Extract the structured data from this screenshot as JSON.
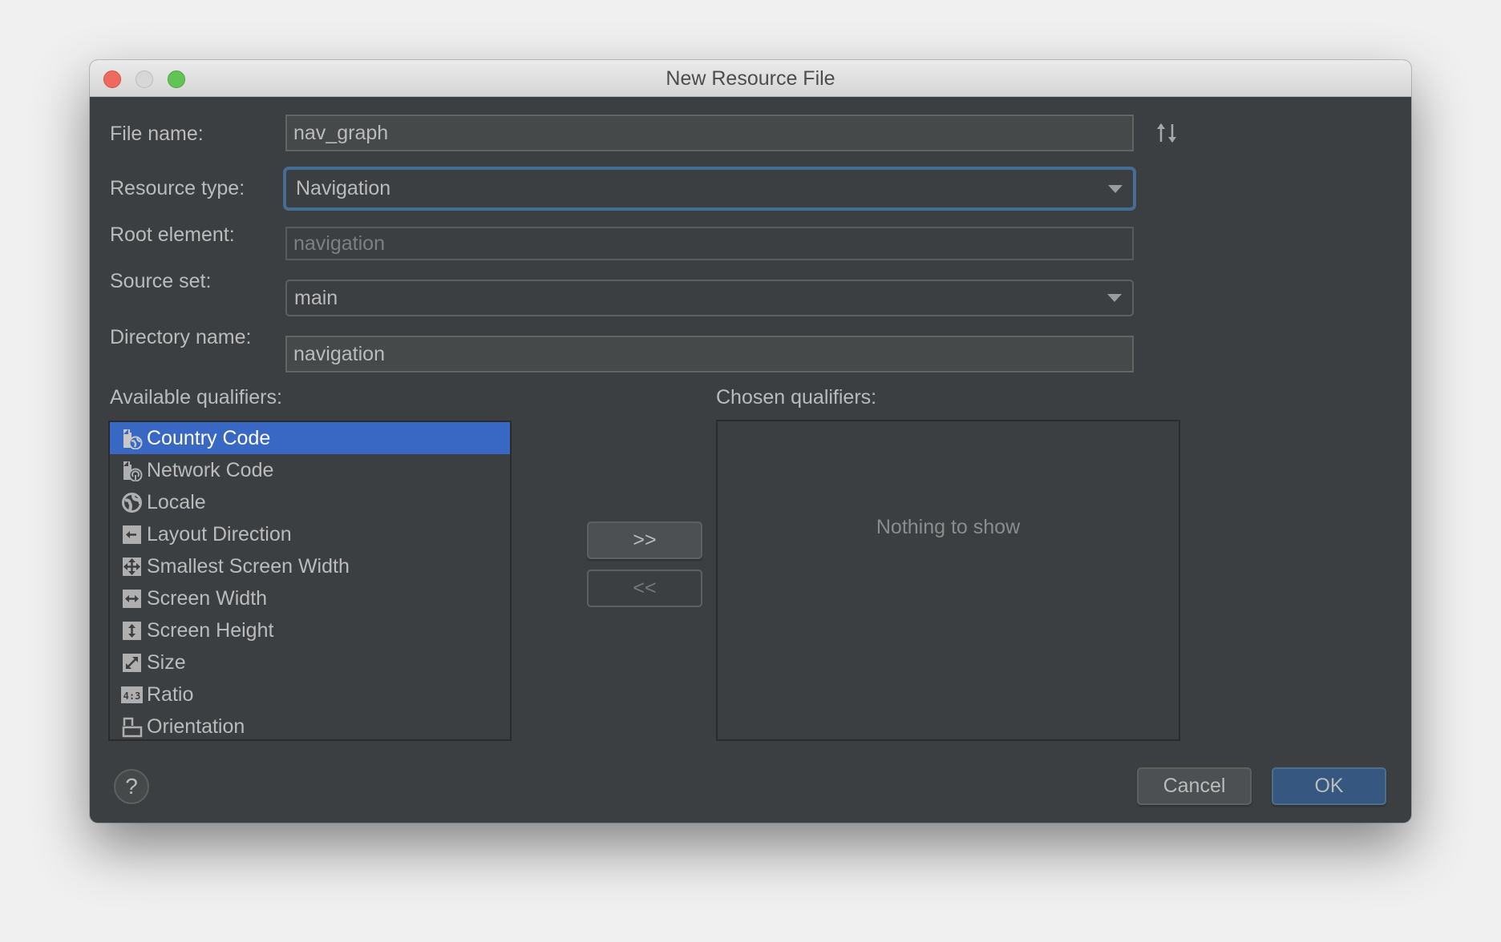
{
  "window": {
    "title": "New Resource File",
    "controls": [
      "close",
      "minimize",
      "maximize"
    ]
  },
  "form": {
    "file_name": {
      "label": "File name:",
      "value": "nav_graph"
    },
    "resource_type": {
      "label": "Resource type:",
      "value": "Navigation"
    },
    "root_element": {
      "label": "Root element:",
      "value": "navigation"
    },
    "source_set": {
      "label": "Source set:",
      "value": "main"
    },
    "directory_name": {
      "label": "Directory name:",
      "value": "navigation"
    },
    "sort_icon": "sort-up-down-icon"
  },
  "available": {
    "label": "Available qualifiers:",
    "items": [
      {
        "label": "Country Code",
        "icon": "country-code-icon",
        "selected": true
      },
      {
        "label": "Network Code",
        "icon": "network-code-icon",
        "selected": false
      },
      {
        "label": "Locale",
        "icon": "globe-icon",
        "selected": false
      },
      {
        "label": "Layout Direction",
        "icon": "layout-direction-icon",
        "selected": false
      },
      {
        "label": "Smallest Screen Width",
        "icon": "smallest-screen-width-icon",
        "selected": false
      },
      {
        "label": "Screen Width",
        "icon": "screen-width-icon",
        "selected": false
      },
      {
        "label": "Screen Height",
        "icon": "screen-height-icon",
        "selected": false
      },
      {
        "label": "Size",
        "icon": "size-icon",
        "selected": false
      },
      {
        "label": "Ratio",
        "icon": "ratio-icon",
        "selected": false
      },
      {
        "label": "Orientation",
        "icon": "orientation-icon",
        "selected": false
      }
    ]
  },
  "transfer": {
    "add_label": ">>",
    "remove_label": "<<"
  },
  "chosen": {
    "label": "Chosen qualifiers:",
    "empty_text": "Nothing to show"
  },
  "footer": {
    "help_label": "?",
    "cancel_label": "Cancel",
    "ok_label": "OK"
  },
  "colors": {
    "dialog_bg": "#3c3f41",
    "selection": "#3867c4",
    "focus_ring": "#466d94",
    "default_button": "#365880"
  }
}
